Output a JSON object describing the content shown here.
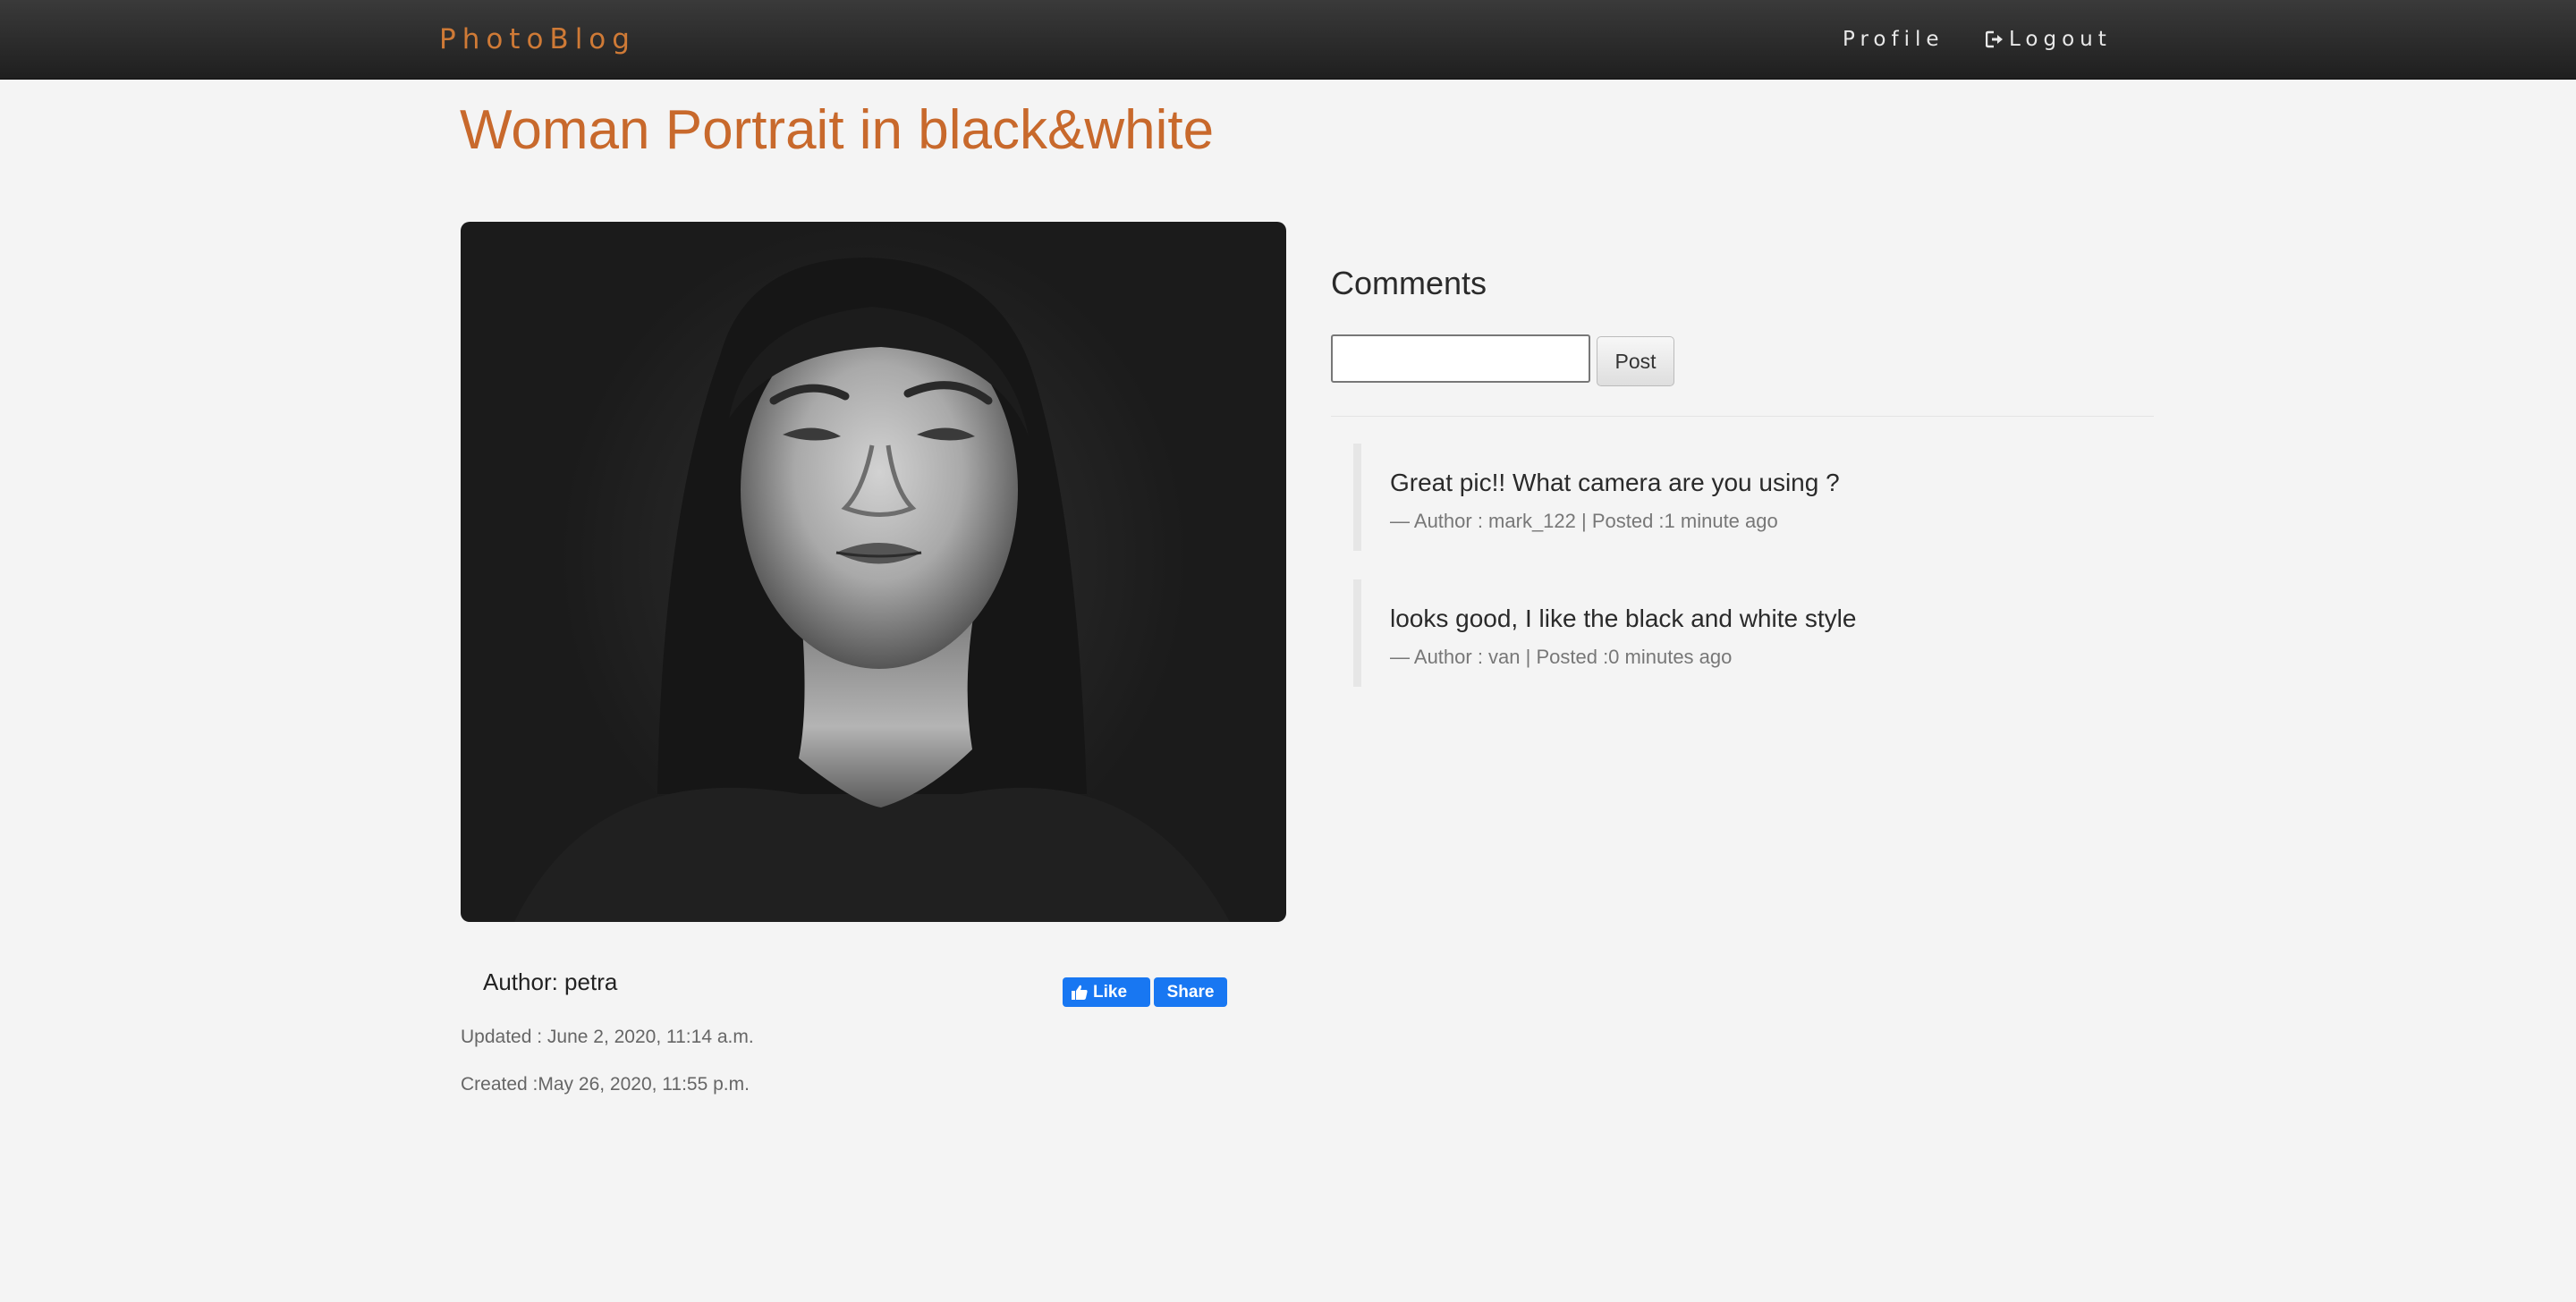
{
  "navbar": {
    "brand": "PhotoBlog",
    "profile_label": "Profile",
    "logout_label": "Logout",
    "logout_icon": "sign-out-icon"
  },
  "post": {
    "title": "Woman Portrait in black&white",
    "image_icon": "portrait-photo",
    "author_label": "Author: petra",
    "updated_label": "Updated : June 2, 2020, 11:14 a.m.",
    "created_label": "Created :May 26, 2020, 11:55 p.m."
  },
  "facebook": {
    "like_label": "Like",
    "share_label": "Share",
    "like_icon": "thumbs-up-icon",
    "color": "#1877f2"
  },
  "comments": {
    "heading": "Comments",
    "input_value": "",
    "post_label": "Post",
    "items": [
      {
        "text": "Great pic!! What camera are you using ?",
        "meta": "— Author : mark_122 | Posted :1 minute ago"
      },
      {
        "text": "looks good, I like the black and white style",
        "meta": "— Author : van | Posted :0 minutes ago"
      }
    ]
  },
  "colors": {
    "accent": "#c8692c",
    "navbar": "#2a2a2a",
    "background": "#f4f4f4"
  }
}
